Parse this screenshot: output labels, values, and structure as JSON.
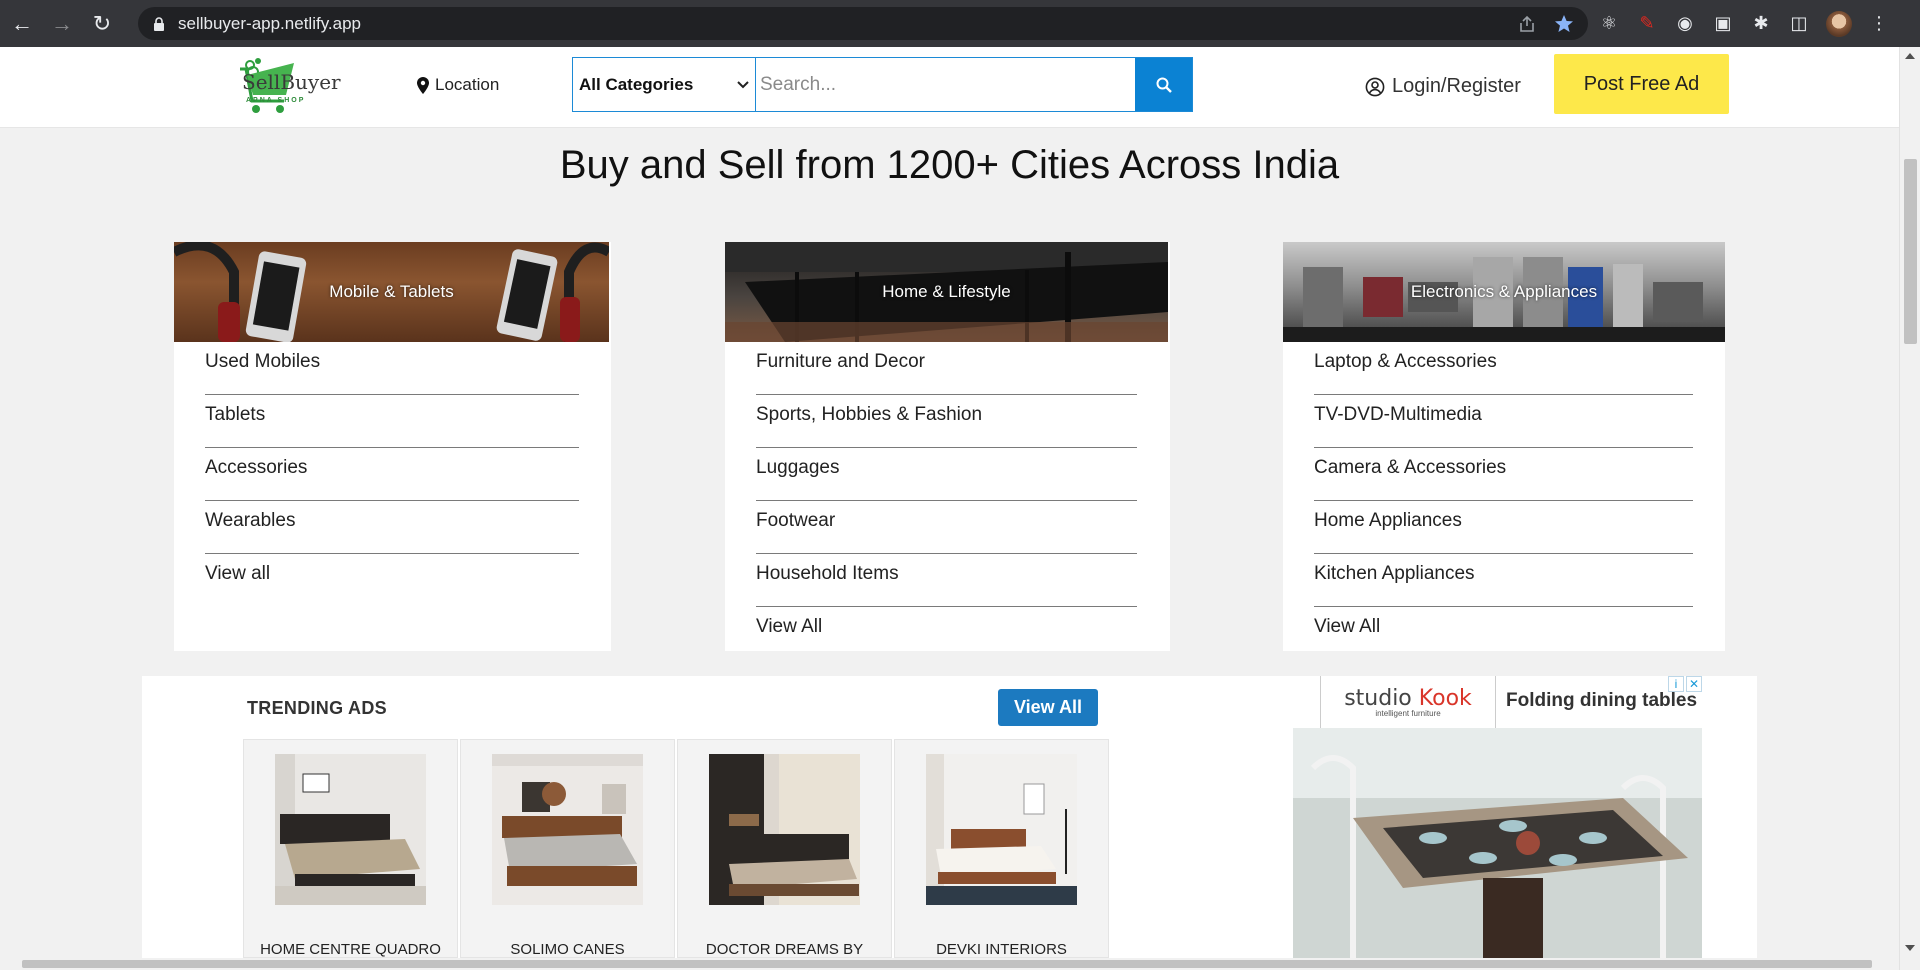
{
  "browser": {
    "url": "sellbuyer-app.netlify.app"
  },
  "header": {
    "logo_title": "SellBuyer",
    "logo_sub": "APNA SHOP",
    "location": "Location",
    "category_select": "All Categories",
    "search_placeholder": "Search...",
    "login": "Login/Register",
    "post_ad": "Post Free Ad"
  },
  "headline": "Buy and Sell from 1200+ Cities Across India",
  "categories": [
    {
      "title": "Mobile & Tablets",
      "items": [
        "Used Mobiles",
        "Tablets",
        "Accessories",
        "Wearables",
        "View all"
      ]
    },
    {
      "title": "Home & Lifestyle",
      "items": [
        "Furniture and Decor",
        "Sports, Hobbies & Fashion",
        "Luggages",
        "Footwear",
        "Household Items",
        "View All"
      ]
    },
    {
      "title": "Electronics & Appliances",
      "items": [
        "Laptop & Accessories",
        "TV-DVD-Multimedia",
        "Camera & Accessories",
        "Home Appliances",
        "Kitchen Appliances",
        "View All"
      ]
    }
  ],
  "trending": {
    "title": "TRENDING ADS",
    "view_all": "View All",
    "ads": [
      {
        "title": "HOME CENTRE QUADRO"
      },
      {
        "title": "SOLIMO CANES"
      },
      {
        "title": "DOCTOR DREAMS BY"
      },
      {
        "title": "DEVKI INTERIORS"
      }
    ]
  },
  "sponsored": {
    "brand": "studio",
    "brand_accent": "Kook",
    "tagline": "intelligent furniture",
    "headline": "Folding dining tables"
  },
  "colors": {
    "accent_blue": "#0b82d3",
    "post_ad_yellow": "#fde84a",
    "view_all_blue": "#1c7ac0"
  }
}
